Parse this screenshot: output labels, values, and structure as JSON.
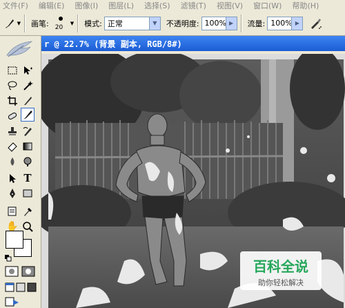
{
  "menubar": {
    "items": [
      "文件(F)",
      "编辑(E)",
      "图像(I)",
      "图层(L)",
      "选择(S)",
      "滤镜(T)",
      "视图(V)",
      "窗口(W)",
      "帮助(H)"
    ]
  },
  "options": {
    "brush_label": "画笔:",
    "brush_size": "20",
    "mode_label": "模式:",
    "mode_value": "正常",
    "opacity_label": "不透明度:",
    "opacity_value": "100%",
    "flow_label": "流量:",
    "flow_value": "100%"
  },
  "document": {
    "title": "r @ 22.7% (背景 副本, RGB/8#)"
  },
  "watermark": {
    "title": "百科全说",
    "subtitle": "助你轻松解决"
  },
  "colors": {
    "accent": "#316ac5",
    "titlebar": "#2a6ae0",
    "watermark_green": "#26a75b"
  }
}
